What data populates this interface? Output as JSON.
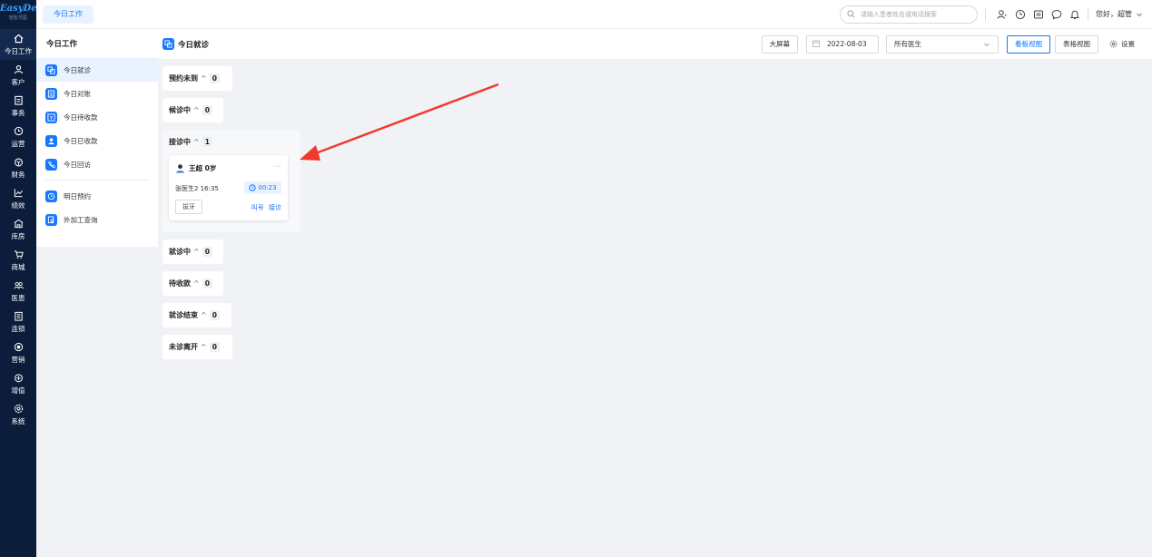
{
  "app": {
    "brand": "EasyDent",
    "brand_sub": "轻松牙医"
  },
  "rail": [
    {
      "label": "今日工作",
      "icon": "home-icon",
      "active": true
    },
    {
      "label": "客户",
      "icon": "user-icon"
    },
    {
      "label": "事务",
      "icon": "clipboard-icon"
    },
    {
      "label": "运营",
      "icon": "clock-icon"
    },
    {
      "label": "财务",
      "icon": "wallet-icon"
    },
    {
      "label": "绩效",
      "icon": "chart-icon"
    },
    {
      "label": "库房",
      "icon": "warehouse-icon"
    },
    {
      "label": "商城",
      "icon": "cart-icon"
    },
    {
      "label": "医患",
      "icon": "people-icon"
    },
    {
      "label": "连锁",
      "icon": "building-icon"
    },
    {
      "label": "营销",
      "icon": "target-icon"
    },
    {
      "label": "增值",
      "icon": "gift-icon"
    },
    {
      "label": "系统",
      "icon": "gear-icon"
    }
  ],
  "topbar": {
    "tab": "今日工作",
    "search_placeholder": "请输入患者姓名或电话搜索",
    "greeting": "您好，超管"
  },
  "sidebar": {
    "title": "今日工作",
    "items": [
      {
        "label": "今日就诊",
        "active": true
      },
      {
        "label": "今日对账"
      },
      {
        "label": "今日待收款"
      },
      {
        "label": "今日已收款"
      },
      {
        "label": "今日回访"
      },
      {
        "label": "明日预约"
      },
      {
        "label": "外加工查询"
      }
    ]
  },
  "header": {
    "title": "今日就诊",
    "bigscreen": "大屏幕",
    "date": "2022-08-03",
    "doctor_select": "所有医生",
    "view_kanban": "看板视图",
    "view_table": "表格视图",
    "settings": "设置"
  },
  "columns": [
    {
      "title": "预约未到",
      "count": "0"
    },
    {
      "title": "候诊中",
      "count": "0"
    },
    {
      "title": "接诊中",
      "count": "1"
    },
    {
      "title": "就诊中",
      "count": "0"
    },
    {
      "title": "待收款",
      "count": "0"
    },
    {
      "title": "就诊结束",
      "count": "0"
    },
    {
      "title": "未诊离开",
      "count": "0"
    }
  ],
  "card": {
    "patient": "王超 0岁",
    "doctor_time": "张医生2  16:35",
    "timer": "00:23",
    "tag": "拔牙",
    "action_call": "叫号",
    "action_receive": "接诊",
    "more": "···"
  },
  "colors": {
    "accent": "#1677ff",
    "rail_bg": "#0b1d3a",
    "arrow": "#f03a2e"
  }
}
